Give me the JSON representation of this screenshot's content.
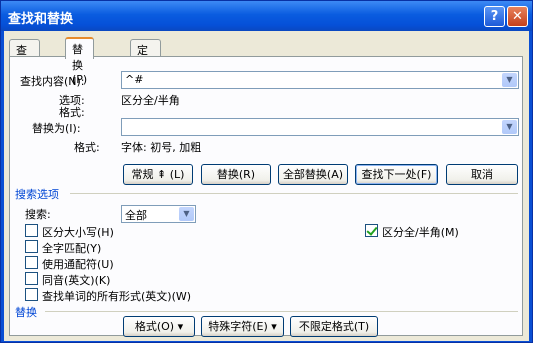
{
  "window": {
    "title": "查找和替换",
    "help_glyph": "?",
    "close_glyph": "✕"
  },
  "tabs": [
    {
      "label": "查找(D)",
      "active": false
    },
    {
      "label": "替换(P)",
      "active": true
    },
    {
      "label": "定位(G)",
      "active": false
    }
  ],
  "find": {
    "label": "查找内容(N):",
    "value": "^#",
    "options_label": "选项:",
    "options_value": "区分全/半角",
    "format_label": "格式:"
  },
  "replace": {
    "label": "替换为(I):",
    "value": "",
    "format_label": "格式:",
    "format_value": "字体: 初号, 加粗"
  },
  "buttons": {
    "normal": "常规 ⇞ (L)",
    "replace": "替换(R)",
    "replace_all": "全部替换(A)",
    "find_next": "查找下一处(F)",
    "cancel": "取消"
  },
  "search_options": {
    "group_label": "搜索选项",
    "search_label": "搜索:",
    "search_value": "全部",
    "checkboxes": [
      {
        "label": "区分大小写(H)",
        "checked": false
      },
      {
        "label": "全字匹配(Y)",
        "checked": false
      },
      {
        "label": "使用通配符(U)",
        "checked": false
      },
      {
        "label": "同音(英文)(K)",
        "checked": false
      },
      {
        "label": "查找单词的所有形式(英文)(W)",
        "checked": false
      }
    ],
    "fullwidth": {
      "label": "区分全/半角(M)",
      "checked": true
    }
  },
  "replace_group": {
    "group_label": "替换",
    "format_button": "格式(O) ▾",
    "special_button": "特殊字符(E) ▾",
    "no_format_button": "不限定格式(T)"
  },
  "colors": {
    "title_bar": "#0a5ce0",
    "tab_accent": "#e68b2c",
    "group_label": "#0046d5",
    "check": "#21a121"
  }
}
